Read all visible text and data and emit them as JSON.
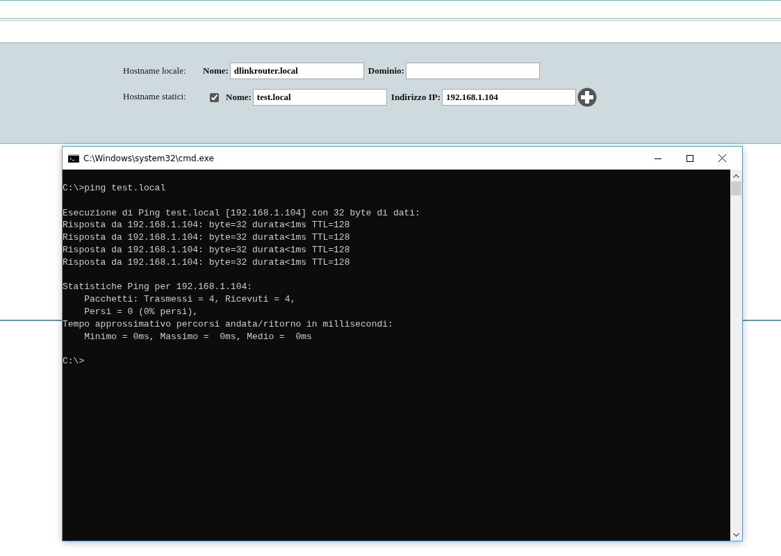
{
  "form": {
    "local_hostname": {
      "label": "Hostname locale:",
      "name_label": "Nome:",
      "name_value": "dlinkrouter.local",
      "domain_label": "Dominio:"
    },
    "static_hostnames": {
      "label": "Hostname statici:",
      "entries": [
        {
          "checked": true,
          "name_label": "Nome:",
          "name_value": "test.local",
          "ip_label": "Indirizzo IP:",
          "ip_value": "192.168.1.104"
        }
      ]
    }
  },
  "console_window": {
    "title": "C:\\Windows\\system32\\cmd.exe",
    "blocks": [
      [
        "C:\\>ping test.local"
      ],
      [
        "Esecuzione di Ping test.local [192.168.1.104] con 32 byte di dati:",
        "Risposta da 192.168.1.104: byte=32 durata<1ms TTL=128",
        "Risposta da 192.168.1.104: byte=32 durata<1ms TTL=128",
        "Risposta da 192.168.1.104: byte=32 durata<1ms TTL=128",
        "Risposta da 192.168.1.104: byte=32 durata<1ms TTL=128"
      ],
      [
        "Statistiche Ping per 192.168.1.104:",
        "    Pacchetti: Trasmessi = 4, Ricevuti = 4,",
        "    Persi = 0 (0% persi),",
        "Tempo approssimativo percorsi andata/ritorno in millisecondi:",
        "    Minimo = 0ms, Massimo =  0ms, Medio =  0ms"
      ],
      [
        "C:\\>"
      ]
    ]
  }
}
